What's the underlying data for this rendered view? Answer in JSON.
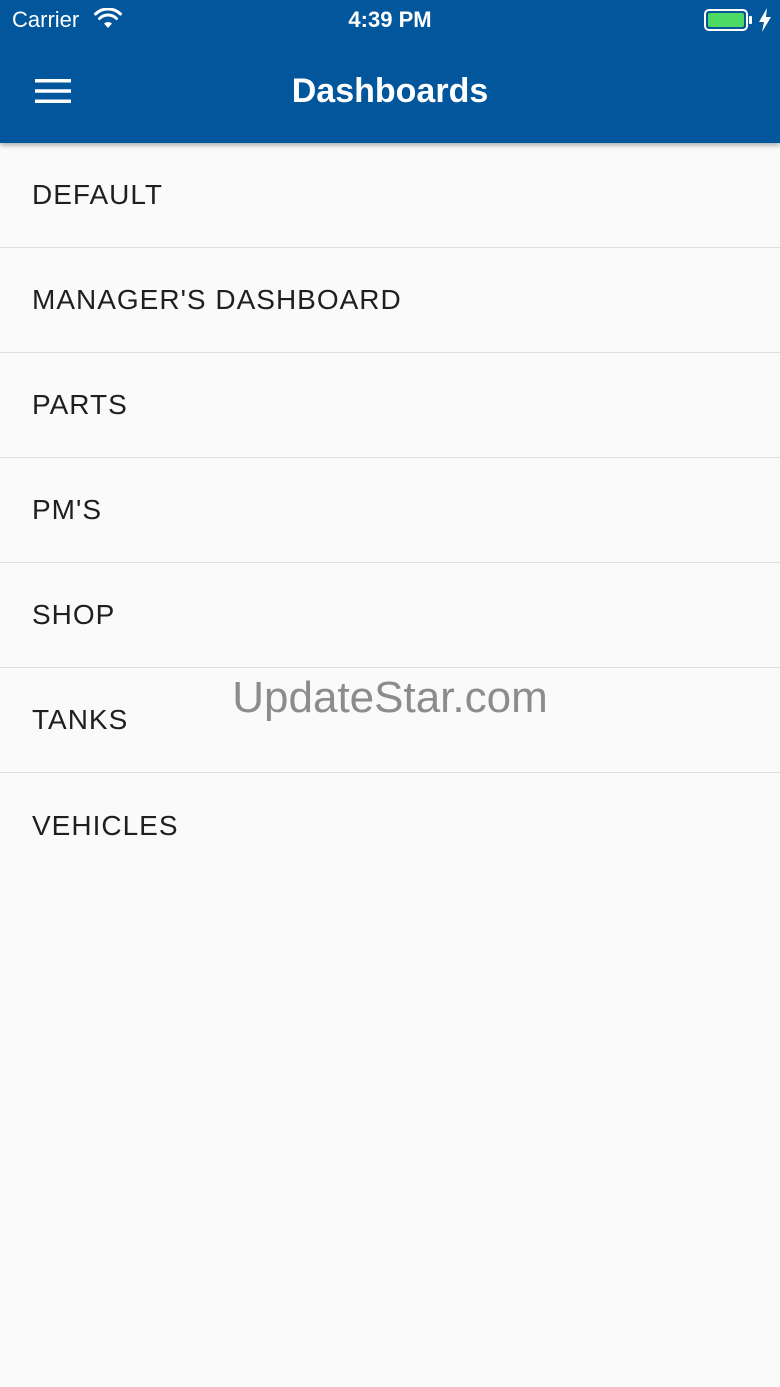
{
  "status_bar": {
    "carrier": "Carrier",
    "time": "4:39 PM",
    "wifi_icon": "wifi-icon",
    "battery_icon": "battery-full-icon",
    "charging_icon": "charging-bolt-icon"
  },
  "header": {
    "title": "Dashboards",
    "menu_icon": "hamburger-menu-icon",
    "background_color": "#02569b"
  },
  "dashboards": [
    {
      "label": "DEFAULT"
    },
    {
      "label": "MANAGER'S DASHBOARD"
    },
    {
      "label": "PARTS"
    },
    {
      "label": "PM'S"
    },
    {
      "label": "SHOP"
    },
    {
      "label": "TANKS"
    },
    {
      "label": "VEHICLES"
    }
  ],
  "watermark": "UpdateStar.com"
}
